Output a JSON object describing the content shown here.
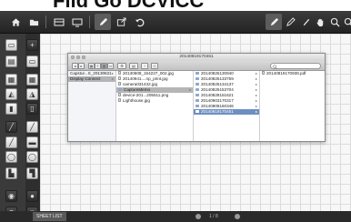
{
  "heading": {
    "text": "Fild Go DCVICC"
  },
  "toolbar": {
    "left_icons": [
      "home-icon",
      "folder-icon",
      "layout-icon",
      "present-icon",
      "pen-icon",
      "export-icon",
      "undo-icon"
    ],
    "right_icons": [
      "pen-icon",
      "pencil-icon",
      "brush-icon",
      "hand-icon",
      "zoom-in-icon",
      "zoom-out-icon"
    ]
  },
  "finder": {
    "title": "20140819170451",
    "columns": [
      {
        "items": [
          {
            "label": "Capstur...S_20130621",
            "arrow": true,
            "selected": false
          },
          {
            "label": "Display Connect",
            "arrow": true,
            "selected": "gray"
          }
        ]
      },
      {
        "items": [
          {
            "label": "20130608_154227_002.jpg",
            "type": "file"
          },
          {
            "label": "20140941....np_print.jpg",
            "type": "file"
          },
          {
            "label": "camera031432.jpg",
            "type": "file"
          },
          {
            "label": "CaptureMemo",
            "type": "folder",
            "arrow": true,
            "selected": "gray"
          },
          {
            "label": "device-201...205511.png",
            "type": "file"
          },
          {
            "label": "Lighthouse.jpg",
            "type": "file"
          }
        ]
      },
      {
        "items": [
          {
            "label": "20140825130940",
            "type": "folder",
            "arrow": true
          },
          {
            "label": "20140825133759",
            "type": "folder",
            "arrow": true
          },
          {
            "label": "20140825134137",
            "type": "folder",
            "arrow": true
          },
          {
            "label": "20140825153704",
            "type": "folder",
            "arrow": true
          },
          {
            "label": "20140828151621",
            "type": "folder",
            "arrow": true
          },
          {
            "label": "20140903170317",
            "type": "folder",
            "arrow": true
          },
          {
            "label": "20140908160346",
            "type": "folder",
            "arrow": true
          },
          {
            "label": "20140819170451",
            "type": "folder",
            "arrow": true,
            "selected": "blue"
          }
        ]
      },
      {
        "items": [
          {
            "label": "20140819170938.pdf",
            "type": "file"
          }
        ]
      }
    ]
  },
  "bottombar": {
    "sheet_label": "SHEET LIST",
    "page_indicator": "1 / 8"
  }
}
